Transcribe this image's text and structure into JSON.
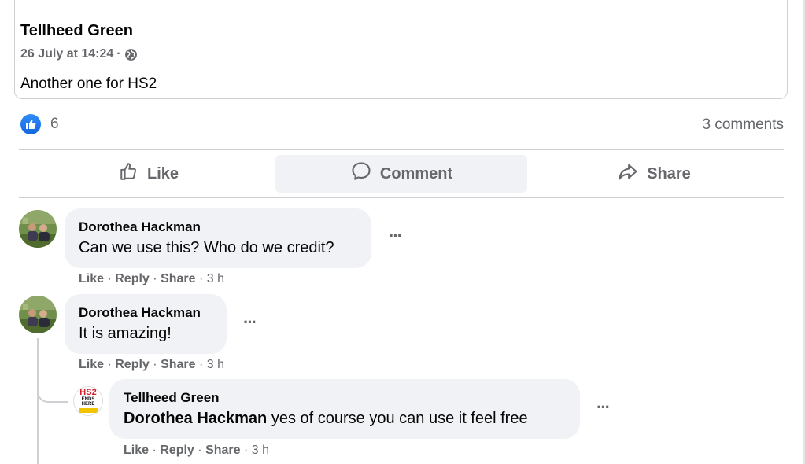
{
  "post": {
    "author": "Tellheed Green",
    "timestamp": "26 July at 14:24",
    "meta_separator": "·",
    "privacy_icon": "globe-icon",
    "text": "Another one for HS2"
  },
  "reactions": {
    "icon": "like-reaction-icon",
    "count": "6",
    "comments_count": "3 comments"
  },
  "actions": {
    "like": "Like",
    "comment": "Comment",
    "share": "Share"
  },
  "comments": [
    {
      "author": "Dorothea Hackman",
      "text": "Can we use this? Who do we credit?",
      "like": "Like",
      "reply": "Reply",
      "share": "Share",
      "time": "3 h",
      "more": "···"
    },
    {
      "author": "Dorothea Hackman",
      "text": "It is amazing!",
      "like": "Like",
      "reply": "Reply",
      "share": "Share",
      "time": "3 h",
      "more": "···"
    },
    {
      "author": "Tellheed Green",
      "mention": "Dorothea Hackman",
      "text": " yes of course you can use it feel free",
      "like": "Like",
      "reply": "Reply",
      "share": "Share",
      "time": "3 h",
      "more": "···",
      "avatar_text": {
        "line1": "HS2",
        "line2": "ENDS",
        "line3": "HERE"
      }
    }
  ],
  "separator": "·",
  "colors": {
    "accent_blue": "#1877f2",
    "secondary_text": "#65676b",
    "bubble_bg": "#f0f2f5",
    "divider": "#ced0d4"
  }
}
